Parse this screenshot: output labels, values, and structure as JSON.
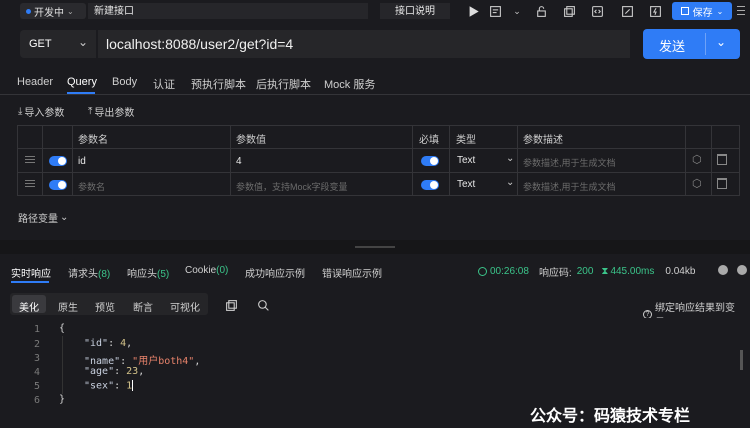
{
  "topbar": {
    "status": "开发中",
    "tab_title": "新建接口",
    "doc_button": "接口说明",
    "save_label": "保存"
  },
  "request": {
    "method": "GET",
    "url": "localhost:8088/user2/get?id=4",
    "send_label": "发送"
  },
  "req_tabs": [
    "Header",
    "Query",
    "Body",
    "认证",
    "预执行脚本",
    "后执行脚本",
    "Mock 服务"
  ],
  "param_actions": {
    "import": "导入参数",
    "export": "导出参数"
  },
  "param_table": {
    "headers": [
      "参数名",
      "参数值",
      "必填",
      "类型",
      "参数描述"
    ],
    "rows": [
      {
        "name": "id",
        "value": "4",
        "type": "Text",
        "desc_placeholder": "参数描述,用于生成文档"
      },
      {
        "name_placeholder": "参数名",
        "value_placeholder": "参数值，支持Mock字段变量",
        "type": "Text",
        "desc_placeholder": "参数描述,用于生成文档"
      }
    ]
  },
  "path_vars": "路径变量",
  "resp_tabs": {
    "realtime": "实时响应",
    "req_headers": "请求头",
    "req_headers_count": "(8)",
    "resp_headers": "响应头",
    "resp_headers_count": "(5)",
    "cookie": "Cookie",
    "cookie_count": "(0)",
    "success_example": "成功响应示例",
    "error_example": "错误响应示例"
  },
  "resp_meta": {
    "time": "00:26:08",
    "code_label": "响应码:",
    "code": "200",
    "duration": "445.00ms",
    "size": "0.04kb"
  },
  "view_tabs": [
    "美化",
    "原生",
    "预览",
    "断言",
    "可视化"
  ],
  "bind_var": "绑定响应结果到变量?",
  "code_lines": [
    "1",
    "2",
    "3",
    "4",
    "5",
    "6"
  ],
  "json": {
    "open": "{",
    "k_id": "\"id\"",
    "v_id": "4",
    "k_name": "\"name\"",
    "v_name": "\"用户both4\"",
    "k_age": "\"age\"",
    "v_age": "23",
    "k_sex": "\"sex\"",
    "v_sex": "1",
    "close": "}"
  },
  "watermark": "公众号：码猿技术专栏",
  "colors": {
    "accent": "#2f7cf6",
    "success": "#3bc48a",
    "string": "#e8836b",
    "number": "#d4c38a",
    "key": "#c9d1e0"
  }
}
